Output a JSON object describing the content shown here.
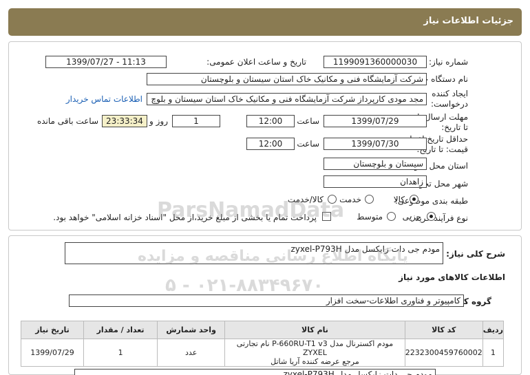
{
  "header": {
    "title": "جزئیات اطلاعات نیاز"
  },
  "fields": {
    "need_number_label": "شماره نیاز:",
    "need_number": "1199091360000030",
    "announce_label": "تاریخ و ساعت اعلان عمومی:",
    "announce_value": "1399/07/27 - 11:13",
    "buyer_label": "نام دستگاه خریدار:",
    "buyer_value": "شرکت آزمایشگاه فنی و مکانیک خاک استان سیستان و بلوچستان",
    "creator_label_1": "ایجاد کننده",
    "creator_label_2": "درخواست:",
    "creator_value": "مجد مودی کارپرداز شرکت آزمایشگاه فنی و مکانیک خاک استان سیستان و بلوچ",
    "contact_link": "اطلاعات تماس خریدار",
    "reply_label_1": "مهلت ارسال پاسخ:",
    "reply_label_2": "تا تاریخ:",
    "reply_date": "1399/07/29",
    "time_label": "ساعت",
    "reply_time": "12:00",
    "days_value": "1",
    "days_label": "روز و",
    "remaining_value": "23:33:34",
    "remaining_label": "ساعت باقی مانده",
    "validity_label_1": "حداقل تاریخ اعتبار",
    "validity_label_2": "قیمت: تا تاریخ:",
    "validity_date": "1399/07/30",
    "validity_time": "12:00",
    "province_label": "استان محل تحویل:",
    "province_value": "سیستان و بلوچستان",
    "city_label": "شهر محل تحویل:",
    "city_value": "زاهدان",
    "category_label": "طبقه بندی موضوعی:",
    "category_options": [
      "کالا",
      "خدمت",
      "کالا/خدمت"
    ],
    "process_label": "نوع فرآیند خرید :",
    "process_options": [
      "جزیی",
      "متوسط"
    ],
    "payment_note": "پرداخت تمام یا بخشی از مبلغ خرید،از محل \"اسناد خزانه اسلامی\" خواهد بود."
  },
  "description": {
    "label": "شرح کلی نیاز:",
    "value": "مودم جی دات زایکسل مدل zyxel-P793H"
  },
  "goods_section": {
    "title": "اطلاعات کالاهای مورد نیاز"
  },
  "group": {
    "label": "گروه کالا:",
    "value": "کامپیوتر و فناوری اطلاعات-سخت افزار"
  },
  "table": {
    "headers": [
      "ردیف",
      "کد کالا",
      "نام کالا",
      "واحد شمارش",
      "تعداد / مقدار",
      "تاریخ نیاز"
    ],
    "rows": [
      {
        "row": "1",
        "code": "2232300459760002",
        "name_line1": "مودم اکسترنال مدل P-660RU-T1 v3 نام تجارتی ZYXEL",
        "name_line2": "مرجع عرضه کننده آریا شاتل",
        "unit": "عدد",
        "qty": "1",
        "date": "1399/07/29"
      }
    ]
  },
  "bottom_partial": "مودم جی دات زایکسل مدل zyxel-P793H",
  "watermark": {
    "brand": "ParsNamadData",
    "line1": "پایگاه اطلاع رسانی مناقصه و مزایده",
    "line2": "۰۲۱-۸۸۳۴۹۶۷۰ - ۵"
  }
}
